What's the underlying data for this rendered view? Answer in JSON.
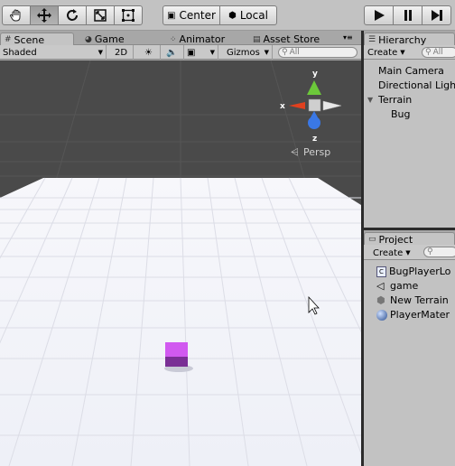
{
  "toolbar": {
    "tools": [
      "hand-tool",
      "move-tool",
      "rotate-tool",
      "scale-tool",
      "rect-tool"
    ],
    "pivot_label": "Center",
    "space_label": "Local"
  },
  "scene_tabs": {
    "tabs": [
      {
        "label": "Scene",
        "icon": "grid-icon"
      },
      {
        "label": "Game",
        "icon": "pacman-icon"
      },
      {
        "label": "Animator",
        "icon": "animator-icon"
      },
      {
        "label": "Asset Store",
        "icon": "bag-icon"
      }
    ]
  },
  "scene_toolbar": {
    "shading": "Shaded",
    "mode_2d": "2D",
    "gizmos": "Gizmos",
    "search_placeholder": "All"
  },
  "gizmo": {
    "y": "y",
    "x": "x",
    "z": "z",
    "projection": "Persp"
  },
  "hierarchy": {
    "title": "Hierarchy",
    "create": "Create",
    "search_placeholder": "All",
    "items": [
      "Main Camera",
      "Directional Ligh",
      "Terrain",
      "Bug"
    ]
  },
  "project": {
    "title": "Project",
    "create": "Create",
    "items": [
      {
        "label": "BugPlayerLo",
        "icon": "script-icon"
      },
      {
        "label": "game",
        "icon": "unity-icon"
      },
      {
        "label": "New Terrain",
        "icon": "cube-icon"
      },
      {
        "label": "PlayerMater",
        "icon": "sphere-icon"
      }
    ]
  },
  "colors": {
    "sky": "#4a4a4a",
    "ground": "#f3f3f8",
    "cube": "#d159f0",
    "gizmo_y": "#6cc83a",
    "gizmo_x": "#e0401e",
    "gizmo_z": "#3a78e6"
  }
}
